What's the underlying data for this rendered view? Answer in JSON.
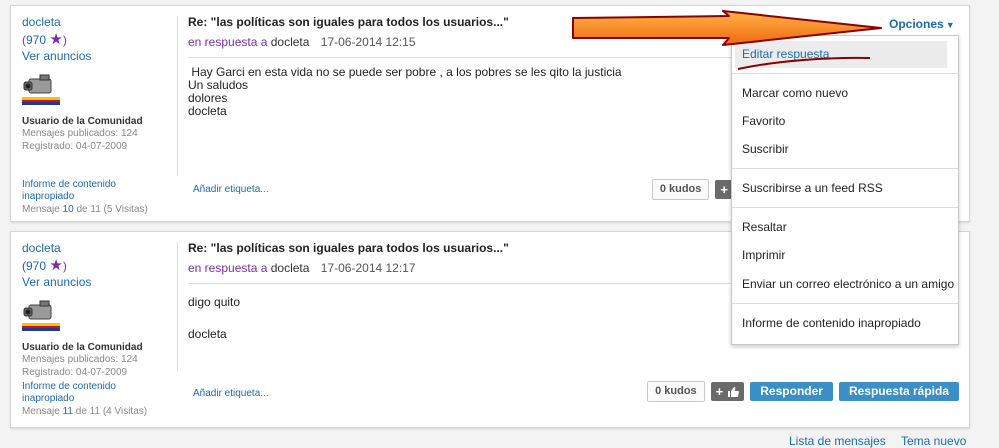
{
  "posts": [
    {
      "author": "docleta",
      "rank": "970",
      "ads": "Ver anuncios",
      "role": "Usuario de la Comunidad",
      "published": "Mensajes publicados: 124",
      "registered": "Registrado: 04-07-2009",
      "report": "Informe de contenido inapropiado",
      "msg_prefix": "Mensaje",
      "msg_num": "10",
      "msg_suffix": "de 11 (5 Visitas)",
      "subject": "Re: \"las políticas son iguales para todos los usuarios...\"",
      "reply_label": "en respuesta a",
      "reply_user": "docleta",
      "date": "17-06-2014 12:15",
      "content": [
        " Hay Garci en esta vida no se puede ser pobre , a los pobres se les qito la justicia",
        "Un saludos",
        "dolores"
      ],
      "signature": "docleta",
      "add_tag": "Añadir etiqueta...",
      "kudos": "0 kudos"
    },
    {
      "author": "docleta",
      "rank": "970",
      "ads": "Ver anuncios",
      "role": "Usuario de la Comunidad",
      "published": "Mensajes publicados: 124",
      "registered": "Registrado: 04-07-2009",
      "report": "Informe de contenido inapropiado",
      "msg_prefix": "Mensaje",
      "msg_num": "11",
      "msg_suffix": "de 11 (4 Visitas)",
      "subject": "Re: \"las políticas son iguales para todos los usuarios...\"",
      "reply_label": "en respuesta a",
      "reply_user": "docleta",
      "date": "17-06-2014 12:17",
      "content": [
        "digo quito"
      ],
      "signature": "docleta",
      "add_tag": "Añadir etiqueta...",
      "kudos": "0 kudos",
      "respond": "Responder",
      "quick_reply": "Respuesta rápida"
    }
  ],
  "options": {
    "label": "Opciones"
  },
  "menu": {
    "items": [
      "Editar respuesta",
      "Marcar como nuevo",
      "Favorito",
      "Suscribir",
      "Suscribirse a un feed RSS",
      "Resaltar",
      "Imprimir",
      "Enviar un correo electrónico a un amigo",
      "Informe de contenido inapropiado"
    ]
  },
  "footer": {
    "list": "Lista de mensajes",
    "next": "Tema nuevo"
  },
  "colors": {
    "link": "#1a6ab5",
    "rank": "#7a2cb0",
    "button": "#3a8fc7",
    "arrow": "#f58220",
    "arrow_outline": "#8b0000"
  }
}
